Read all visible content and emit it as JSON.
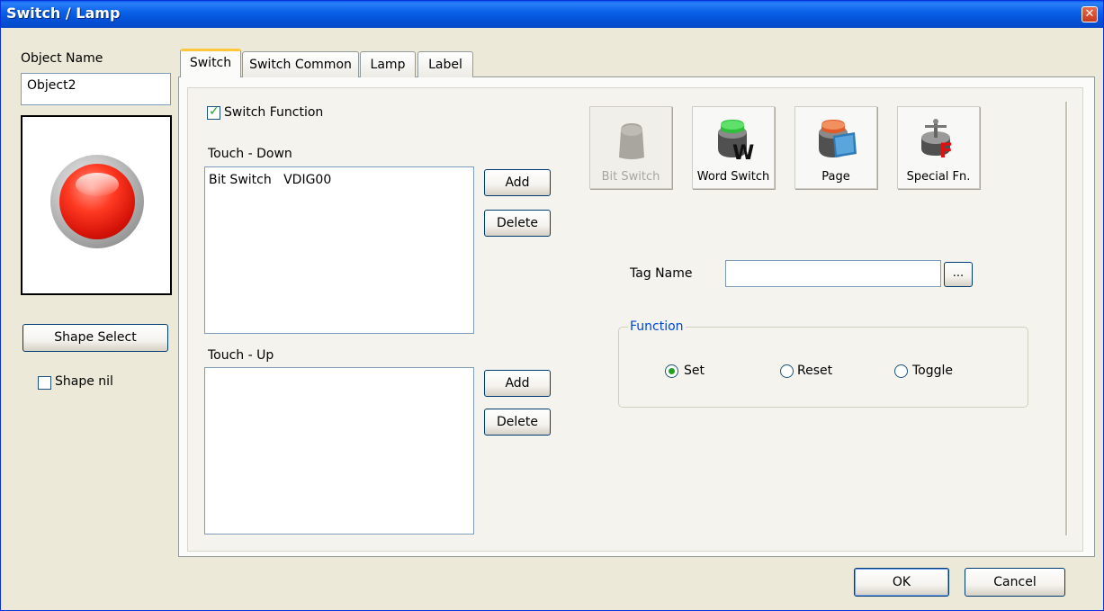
{
  "window": {
    "title": "Switch / Lamp"
  },
  "left": {
    "object_name_label": "Object Name",
    "object_name_value": "Object2",
    "shape_select_label": "Shape Select",
    "shape_nil_label": "Shape nil",
    "shape_nil_checked": false
  },
  "tabs": [
    {
      "label": "Switch",
      "active": true
    },
    {
      "label": "Switch Common",
      "active": false
    },
    {
      "label": "Lamp",
      "active": false
    },
    {
      "label": "Label",
      "active": false
    }
  ],
  "switch_tab": {
    "switch_function_label": "Switch Function",
    "switch_function_checked": true,
    "touch_down_label": "Touch - Down",
    "touch_down_items": [
      {
        "type": "Bit Switch",
        "tag": "VDIG00"
      }
    ],
    "touch_up_label": "Touch - Up",
    "touch_up_items": [],
    "add_label": "Add",
    "delete_label": "Delete",
    "tool_buttons": [
      {
        "label": "Bit Switch",
        "icon": "bit-switch-icon",
        "enabled": false
      },
      {
        "label": "Word Switch",
        "icon": "word-switch-icon",
        "enabled": true
      },
      {
        "label": "Page",
        "icon": "page-icon",
        "enabled": true
      },
      {
        "label": "Special Fn.",
        "icon": "special-fn-icon",
        "enabled": true
      }
    ],
    "tag_name_label": "Tag Name",
    "tag_name_value": "",
    "browse_label": "...",
    "function_group_label": "Function",
    "function_options": [
      {
        "label": "Set",
        "selected": true
      },
      {
        "label": "Reset",
        "selected": false
      },
      {
        "label": "Toggle",
        "selected": false
      }
    ]
  },
  "footer": {
    "ok_label": "OK",
    "cancel_label": "Cancel"
  }
}
